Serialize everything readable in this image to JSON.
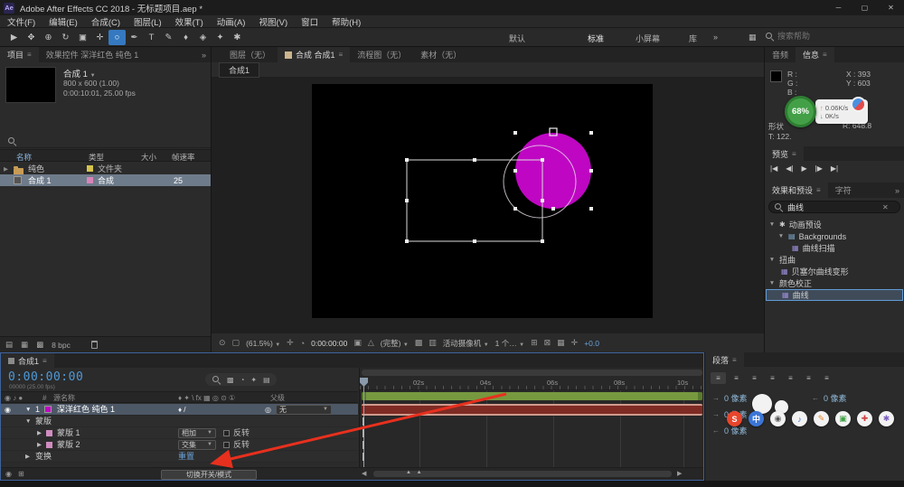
{
  "colors": {
    "accent_blue": "#4e9ad8",
    "magenta": "#bf06c3",
    "project_selection": "#6e7b8a",
    "timeline_selection": "#4d5866",
    "tool_active_blue": "#3579c0",
    "arrow_red": "#e8301e",
    "work_area_green": "#76993f",
    "layer_bar_red": "#7e2b24",
    "layer_bar_edge": "#d09a8c",
    "overlay_green": "#43a047"
  },
  "titlebar": {
    "app_icon": "Ae",
    "title": "Adobe After Effects CC 2018 - 无标题项目.aep *",
    "minimize": "─",
    "maximize": "▢",
    "close": "✕"
  },
  "menubar": {
    "items": [
      "文件(F)",
      "编辑(E)",
      "合成(C)",
      "图层(L)",
      "效果(T)",
      "动画(A)",
      "视图(V)",
      "窗口",
      "帮助(H)"
    ]
  },
  "toolbar": {
    "tools": [
      "▶",
      "✥",
      "⊕",
      "↻",
      "▣",
      "✛",
      "○",
      "✒",
      "T",
      "✎",
      "♦",
      "◈",
      "✦",
      "✱"
    ],
    "workspace_menu": "默认",
    "workspaces": [
      "标准",
      "小屏幕",
      "库"
    ],
    "overflow": "»",
    "misc_icon": "▦",
    "search_placeholder": "搜索帮助"
  },
  "project": {
    "tab_project": "项目",
    "tab_effects": "效果控件 深洋红色 纯色 1",
    "panel_menu": "≡",
    "overflow": "»",
    "comp_name": "合成 1",
    "comp_caret": "▼",
    "comp_size": "800 x 600 (1.00)",
    "comp_duration": "0:00:10:01, 25.00 fps",
    "columns": {
      "name": "名称",
      "type": "类型",
      "size": "大小",
      "fps": "帧速率"
    },
    "rows": [
      {
        "twirl": "▶",
        "name": "纯色",
        "type": "文件夹",
        "fps": ""
      },
      {
        "twirl": "",
        "name": "合成 1",
        "type": "合成",
        "fps": "25"
      }
    ],
    "footer_icons": [
      "▤",
      "▦",
      "▩"
    ],
    "bpc": "8 bpc"
  },
  "viewer": {
    "tab_layer": "图层（无）",
    "tab_comp": "合成 合成1",
    "tab_flow": "流程图（无）",
    "tab_footage": "素材（无）",
    "panel_menu": "≡",
    "comp_nav_tab": "合成1",
    "zoom": "(61.5%)",
    "caret": "▼",
    "time": "0:00:00:00",
    "resolution": "(完整)",
    "renderer": "活动摄像机",
    "views": "1 个…",
    "exposure": "+0.0",
    "icons": [
      "⊙",
      "▢",
      "✛",
      "◔",
      "▣",
      "△",
      "▩",
      "▥",
      "⊞",
      "⊠",
      "▦",
      "✛"
    ]
  },
  "info": {
    "tab_audio": "音频",
    "tab_info": "信息",
    "panel_menu": "≡",
    "r": "R :",
    "g": "G :",
    "b": "B :",
    "x": "X : 393",
    "y": "Y : 603",
    "shape": "形状",
    "t_value": "T: 122.",
    "r_value": "R: 648.8"
  },
  "preview": {
    "title": "预览",
    "panel_menu": "≡",
    "buttons": [
      "|◀",
      "◀|",
      "▶",
      "|▶",
      "▶|"
    ]
  },
  "effects": {
    "tab_effects": "效果和预设",
    "tab_character": "字符",
    "panel_menu": "≡",
    "overflow": "»",
    "search_value": "曲线",
    "clear": "✕",
    "tree": [
      {
        "twirl": "▼",
        "icon": "✱",
        "label": "动画预设"
      },
      {
        "twirl": "▼",
        "icon": "▤",
        "label": "Backgrounds"
      },
      {
        "twirl": "",
        "icon": "▦",
        "label": "曲线扫描"
      },
      {
        "twirl": "▼",
        "icon": "",
        "label": "扭曲"
      },
      {
        "twirl": "",
        "icon": "▦",
        "label": "贝塞尔曲线变形"
      },
      {
        "twirl": "▼",
        "icon": "",
        "label": "颜色校正"
      },
      {
        "twirl": "",
        "icon": "▦",
        "label": "曲线"
      }
    ]
  },
  "timeline": {
    "tab": "合成1",
    "panel_menu": "≡",
    "timecode": "0:00:00:00",
    "timecode_sub": "00000 (25.00 fps)",
    "icon_cluster": [
      "▩",
      "◔",
      "✦",
      "▤"
    ],
    "header": {
      "av": "◉ ♪ ●",
      "num": "#",
      "source": "源名称",
      "switches": "♦ ✦ \\ fx ▦ ◎ ⊙ ①",
      "parent": "父级"
    },
    "layer": {
      "eye": "◉",
      "twirl": "▼",
      "num": "1",
      "name": "深洋红色 纯色 1",
      "switches": "♦  /",
      "pickwhip": "◎",
      "parent": "无",
      "caret": "▼"
    },
    "masks_group": {
      "twirl": "▼",
      "label": "蒙版"
    },
    "mask1": {
      "twirl": "▶",
      "label": "蒙版 1",
      "mode": "相加",
      "caret": "▼",
      "invert": "反转"
    },
    "mask2": {
      "twirl": "▶",
      "label": "蒙版 2",
      "mode": "交集",
      "caret": "▼",
      "invert": "反转"
    },
    "transform": {
      "twirl": "▶",
      "label": "变换",
      "reset": "重置"
    },
    "bottom_icons": [
      "◉",
      "⊞"
    ],
    "toggle_button": "切换开关/模式",
    "ruler": [
      "02s",
      "04s",
      "06s",
      "08s",
      "10s"
    ],
    "scroll_left": "◀",
    "scroll_right": "▶",
    "zoom_handles": "▲ ▲"
  },
  "paragraph": {
    "title": "段落",
    "panel_menu": "≡",
    "align_icons": [
      "≡",
      "≡",
      "≡",
      "≡",
      "≡",
      "≡",
      "≡"
    ],
    "fields": [
      {
        "icon": "→",
        "value": "0 像素"
      },
      {
        "icon": "←",
        "value": "0 像素"
      },
      {
        "icon": "→",
        "value": "0 像素"
      },
      {
        "icon": "←",
        "value": "0 像素"
      }
    ]
  },
  "overlay": {
    "percent": "68%",
    "up_arrow": "↑",
    "up": "0.06K/s",
    "down_arrow": "↓",
    "down": "0K/s",
    "recorder": [
      {
        "glyph": "S",
        "bg": "#e8452c",
        "fg": "#ffffff"
      },
      {
        "glyph": "中",
        "bg": "#3b76d6",
        "fg": "#ffffff"
      },
      {
        "glyph": "◉",
        "bg": "#f2f2f2",
        "fg": "#555555"
      },
      {
        "glyph": "♪",
        "bg": "#f2f2f2",
        "fg": "#3b76d6"
      },
      {
        "glyph": "✎",
        "bg": "#f2f2f2",
        "fg": "#e8882c"
      },
      {
        "glyph": "▣",
        "bg": "#f2f2f2",
        "fg": "#44a048"
      },
      {
        "glyph": "✚",
        "bg": "#f2f2f2",
        "fg": "#d04040"
      },
      {
        "glyph": "✱",
        "bg": "#f2f2f2",
        "fg": "#7a5fc0"
      }
    ]
  }
}
